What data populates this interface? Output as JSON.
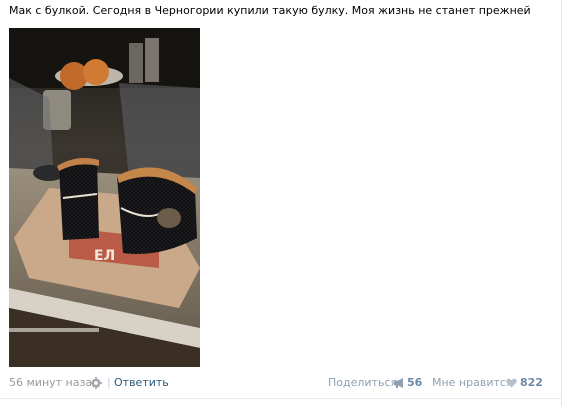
{
  "post": {
    "text": "Мак с булкой. Сегодня в Черногории купили такую булку. Моя жизнь не станет прежней"
  },
  "photo": {
    "label": "ЕЛ"
  },
  "footer": {
    "time": "56 минут назад",
    "separator": "|",
    "reply_label": "Ответить",
    "share_label": "Поделиться",
    "share_count": "56",
    "like_label": "Мне нравится",
    "like_count": "822"
  },
  "colors": {
    "link": "#2b587a",
    "muted": "#999999",
    "action": "#8fa1b3"
  },
  "icons": {
    "settings": "gear-icon",
    "share": "megaphone-icon",
    "like": "heart-icon"
  }
}
